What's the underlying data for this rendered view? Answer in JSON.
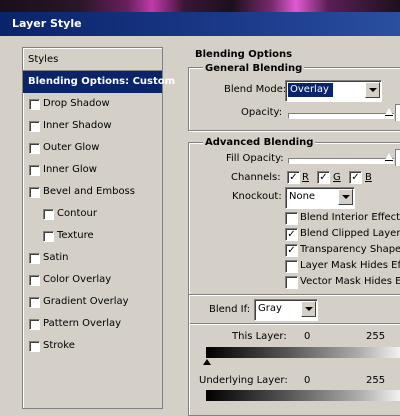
{
  "window": {
    "title": "Layer Style"
  },
  "styles_panel": {
    "header": "Styles",
    "items": [
      {
        "label": "Blending Options: Custom",
        "selected": true,
        "checkbox": false
      },
      {
        "label": "Drop Shadow",
        "checked": false
      },
      {
        "label": "Inner Shadow",
        "checked": false
      },
      {
        "label": "Outer Glow",
        "checked": false
      },
      {
        "label": "Inner Glow",
        "checked": false
      },
      {
        "label": "Bevel and Emboss",
        "checked": false
      },
      {
        "label": "Contour",
        "checked": false,
        "indent": true
      },
      {
        "label": "Texture",
        "checked": false,
        "indent": true
      },
      {
        "label": "Satin",
        "checked": false
      },
      {
        "label": "Color Overlay",
        "checked": false
      },
      {
        "label": "Gradient Overlay",
        "checked": false
      },
      {
        "label": "Pattern Overlay",
        "checked": false
      },
      {
        "label": "Stroke",
        "checked": false
      }
    ]
  },
  "blending": {
    "section_title": "Blending Options",
    "general_title": "General Blending",
    "blend_mode_label": "Blend Mode:",
    "blend_mode_value": "Overlay",
    "opacity_label": "Opacity:",
    "advanced_title": "Advanced Blending",
    "fill_opacity_label": "Fill Opacity:",
    "channels_label": "Channels:",
    "channels": [
      {
        "label": "R",
        "checked": true
      },
      {
        "label": "G",
        "checked": true
      },
      {
        "label": "B",
        "checked": true
      }
    ],
    "knockout_label": "Knockout:",
    "knockout_value": "None",
    "options": [
      {
        "label": "Blend Interior Effects a",
        "checked": false
      },
      {
        "label": "Blend Clipped Layers a",
        "checked": true
      },
      {
        "label": "Transparency Shapes",
        "checked": true
      },
      {
        "label": "Layer Mask Hides Effec",
        "checked": false
      },
      {
        "label": "Vector Mask Hides Effe",
        "checked": false
      }
    ],
    "blend_if_label": "Blend If:",
    "blend_if_value": "Gray",
    "this_layer_label": "This Layer:",
    "this_layer_min": "0",
    "this_layer_max": "255",
    "underlying_label": "Underlying Layer:",
    "underlying_min": "0",
    "underlying_max": "255"
  },
  "colors": {
    "title_bar": "#0a246a",
    "selection": "#0a246a",
    "dialog_bg": "#d4d0c8"
  }
}
